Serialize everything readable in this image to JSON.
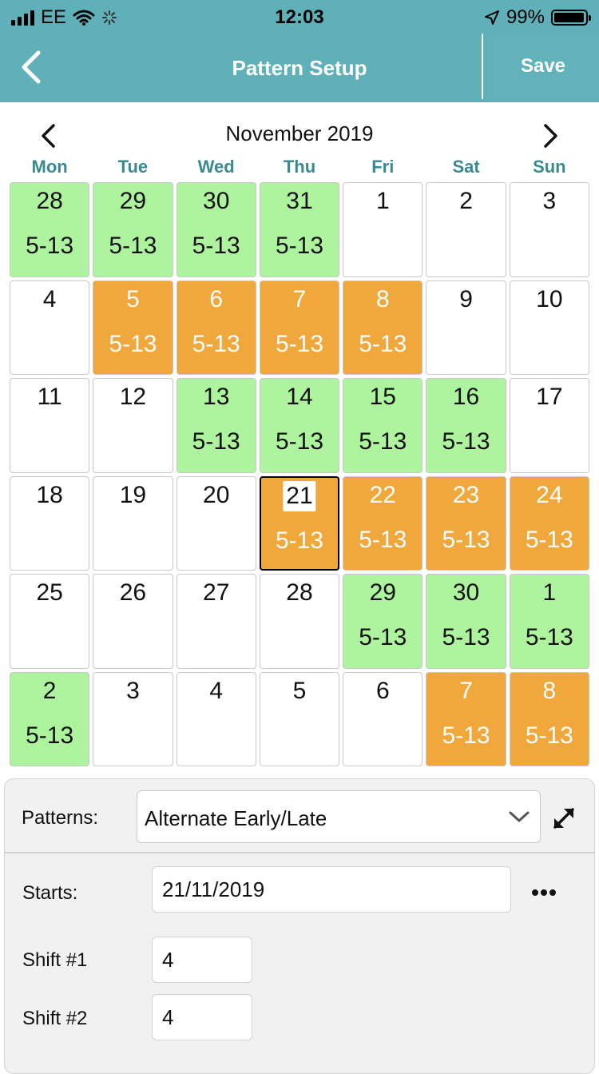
{
  "status_bar": {
    "carrier": "EE",
    "time": "12:03",
    "battery": "99%"
  },
  "nav": {
    "title": "Pattern Setup",
    "save_label": "Save"
  },
  "calendar": {
    "month_title": "November 2019",
    "weekdays": [
      "Mon",
      "Tue",
      "Wed",
      "Thu",
      "Fri",
      "Sat",
      "Sun"
    ],
    "days": [
      {
        "day": "28",
        "shift": "5-13",
        "state": "green"
      },
      {
        "day": "29",
        "shift": "5-13",
        "state": "green"
      },
      {
        "day": "30",
        "shift": "5-13",
        "state": "green"
      },
      {
        "day": "31",
        "shift": "5-13",
        "state": "green"
      },
      {
        "day": "1",
        "shift": "",
        "state": "none"
      },
      {
        "day": "2",
        "shift": "",
        "state": "none"
      },
      {
        "day": "3",
        "shift": "",
        "state": "none"
      },
      {
        "day": "4",
        "shift": "",
        "state": "none"
      },
      {
        "day": "5",
        "shift": "5-13",
        "state": "orange"
      },
      {
        "day": "6",
        "shift": "5-13",
        "state": "orange"
      },
      {
        "day": "7",
        "shift": "5-13",
        "state": "orange"
      },
      {
        "day": "8",
        "shift": "5-13",
        "state": "orange"
      },
      {
        "day": "9",
        "shift": "",
        "state": "none"
      },
      {
        "day": "10",
        "shift": "",
        "state": "none"
      },
      {
        "day": "11",
        "shift": "",
        "state": "none"
      },
      {
        "day": "12",
        "shift": "",
        "state": "none"
      },
      {
        "day": "13",
        "shift": "5-13",
        "state": "green"
      },
      {
        "day": "14",
        "shift": "5-13",
        "state": "green"
      },
      {
        "day": "15",
        "shift": "5-13",
        "state": "green"
      },
      {
        "day": "16",
        "shift": "5-13",
        "state": "green"
      },
      {
        "day": "17",
        "shift": "",
        "state": "none"
      },
      {
        "day": "18",
        "shift": "",
        "state": "none"
      },
      {
        "day": "19",
        "shift": "",
        "state": "none"
      },
      {
        "day": "20",
        "shift": "",
        "state": "none"
      },
      {
        "day": "21",
        "shift": "5-13",
        "state": "orange",
        "selected": true
      },
      {
        "day": "22",
        "shift": "5-13",
        "state": "orange"
      },
      {
        "day": "23",
        "shift": "5-13",
        "state": "orange"
      },
      {
        "day": "24",
        "shift": "5-13",
        "state": "orange"
      },
      {
        "day": "25",
        "shift": "",
        "state": "none"
      },
      {
        "day": "26",
        "shift": "",
        "state": "none"
      },
      {
        "day": "27",
        "shift": "",
        "state": "none"
      },
      {
        "day": "28",
        "shift": "",
        "state": "none"
      },
      {
        "day": "29",
        "shift": "5-13",
        "state": "green"
      },
      {
        "day": "30",
        "shift": "5-13",
        "state": "green"
      },
      {
        "day": "1",
        "shift": "5-13",
        "state": "green"
      },
      {
        "day": "2",
        "shift": "5-13",
        "state": "green"
      },
      {
        "day": "3",
        "shift": "",
        "state": "none"
      },
      {
        "day": "4",
        "shift": "",
        "state": "none"
      },
      {
        "day": "5",
        "shift": "",
        "state": "none"
      },
      {
        "day": "6",
        "shift": "",
        "state": "none"
      },
      {
        "day": "7",
        "shift": "5-13",
        "state": "orange"
      },
      {
        "day": "8",
        "shift": "5-13",
        "state": "orange"
      }
    ]
  },
  "form": {
    "patterns_label": "Patterns:",
    "pattern_value": "Alternate Early/Late",
    "starts_label": "Starts:",
    "starts_value": "21/11/2019",
    "shift1_label": "Shift #1",
    "shift1_value": "4",
    "shift2_label": "Shift #2",
    "shift2_value": "4"
  },
  "colors": {
    "header": "#5fb0b8",
    "weekday_text": "#3a8a92",
    "early_green": "#aef39e",
    "late_orange": "#f0a83d"
  },
  "icons": [
    "signal-icon",
    "wifi-icon",
    "loading-icon",
    "location-arrow-icon",
    "battery-icon",
    "back-chevron-icon",
    "chevron-left-icon",
    "chevron-right-icon",
    "chevron-down-icon",
    "expand-icon",
    "more-icon"
  ]
}
